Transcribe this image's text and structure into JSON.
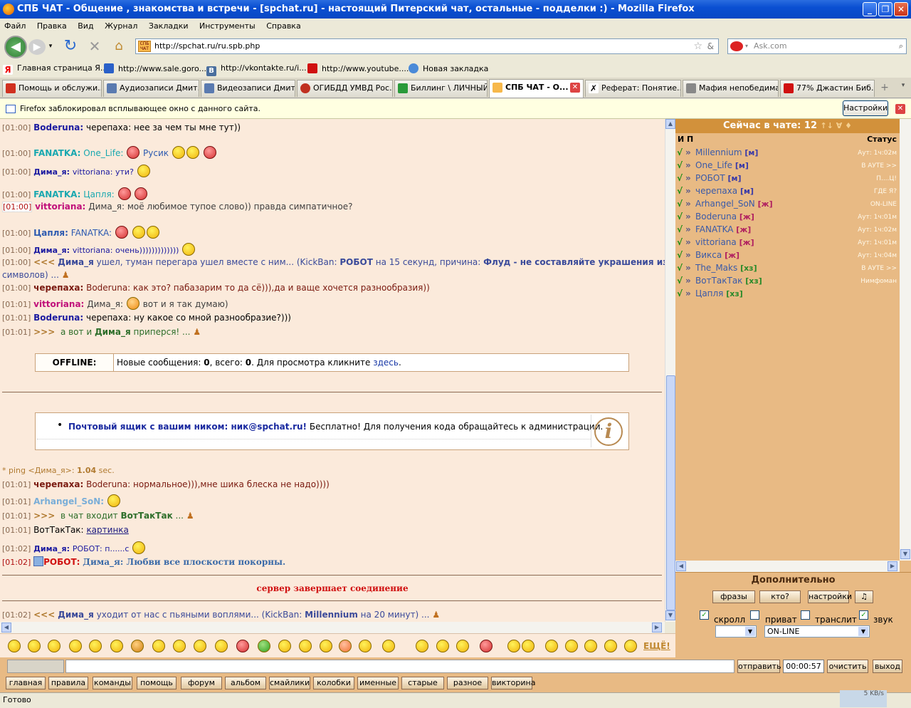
{
  "window": {
    "title": "СПБ ЧАТ - Общение , знакомства и встречи - [spchat.ru] - настоящий Питерский чат, остальные - подделки :) - Mozilla Firefox",
    "min": "_",
    "max": "❐",
    "close": "✕"
  },
  "menu": [
    "Файл",
    "Правка",
    "Вид",
    "Журнал",
    "Закладки",
    "Инструменты",
    "Справка"
  ],
  "nav": {
    "url": "http://spchat.ru/ru.spb.php",
    "url_icon_text": "СПБ ЧАТ",
    "search_placeholder": "Ask.com"
  },
  "bookmarks": [
    "Главная страница Я...",
    "http://www.sale.goro...",
    "http://vkontakte.ru/i...",
    "http://www.youtube....",
    "Новая закладка"
  ],
  "tabs": [
    "Помощь и обслужи...",
    "Аудиозаписи Дмит...",
    "Видеозаписи Дмит...",
    "ОГИБДД УМВД Рос...",
    "Биллинг \\ ЛИЧНЫЙ...",
    "СПБ ЧАТ - О...",
    "Реферат: Понятие...",
    "Мафия непобедима",
    "77% Джастин Биб..."
  ],
  "notification": {
    "text": "Firefox заблокировал всплывающее окно с данного сайта.",
    "button": "Настройки"
  },
  "chat": {
    "messages": [
      {
        "time": "[01:00]",
        "nick": "Boderuna:",
        "text": "черепаха: нее за чем ты мне тут))"
      },
      {
        "time": "[01:00]",
        "nick": "FANATKA:",
        "text": "One_Life:",
        "text2": "Русик"
      },
      {
        "time": "[01:00]",
        "nick": "Дима_я:",
        "text": "vittoriana: ути?"
      },
      {
        "time": "[01:00]",
        "nick": "FANATKA:",
        "text": "Цапля:"
      },
      {
        "time": "[01:00]",
        "nick": "vittoriana:",
        "text": "Дима_я: моё любимое тупое слово)) правда симпатичное?"
      },
      {
        "time": "[01:00]",
        "nick": "Цапля:",
        "text": "FANATKA:"
      },
      {
        "time": "[01:00]",
        "nick": "Дима_я:",
        "text": "vittoriana: очень)))))))))))))"
      },
      {
        "time": "[01:00]",
        "arrows": "<<<",
        "nick": "Дима_я",
        "text": "ушел, туман перегара ушел вместе с ним... (KickBan:",
        "bot": "РОБОТ",
        "text2": "на 15 секунд, причина:",
        "reason": "Флуд - не составляйте украшения из",
        "text3": "символов) ..."
      },
      {
        "time": "[01:00]",
        "nick": "черепаха:",
        "text": "Boderuna: как это? пабазарим то да сё))),да и ваще хочется разнообразия))"
      },
      {
        "time": "[01:01]",
        "nick": "vittoriana:",
        "text": "Дима_я:",
        "text2": "вот и я так думаю)"
      },
      {
        "time": "[01:01]",
        "nick": "Boderuna:",
        "text": "черепаха: ну какое со мной разнообразие?)))"
      },
      {
        "time": "[01:01]",
        "arrows": ">>>",
        "pre": "а вот и",
        "nick": "Дима_я",
        "text": "приперся! ..."
      }
    ],
    "offline": {
      "label": "OFFLINE:",
      "pre": "Новые сообщения:",
      "new": "0",
      "mid": ", всего:",
      "total": "0",
      "post": ". Для просмотра кликните",
      "link": "здесь",
      "end": "."
    },
    "info": {
      "bold": "Почтовый ящик с вашим ником: ник@spchat.ru!",
      "rest": "Бесплатно! Для получения кода обращайтесь к администрации."
    },
    "ping": {
      "pre": "* ping <Дима_я>:",
      "value": "1.04",
      "unit": "sec."
    },
    "messages2": [
      {
        "time": "[01:01]",
        "nick": "черепаха:",
        "text": "Boderuna: нормальное))),мне шика блеска не надо))))"
      },
      {
        "time": "[01:01]",
        "nick": "Arhangel_SoN:"
      },
      {
        "time": "[01:01]",
        "arrows": ">>>",
        "pre": "в чат входит",
        "nick": "ВотТакТак",
        "text": "..."
      },
      {
        "time": "[01:01]",
        "nick": "ВотТакТак:",
        "link": "картинка"
      },
      {
        "time": "[01:02]",
        "nick": "Дима_я:",
        "text": "РОБОТ: п......с"
      },
      {
        "time": "[01:02]",
        "nick": "РОБОТ:",
        "text": "Дима_я: Любви все плоскости покорны."
      }
    ],
    "server": "сервер завершает соединение",
    "last": {
      "time": "[01:02]",
      "arrows": "<<<",
      "nick": "Дима_я",
      "text": "уходит от нас с пьяными воплями... (KickBan:",
      "bot": "Millennium",
      "text2": "на 20 минут) ..."
    }
  },
  "smileys": {
    "more": "ЕЩЁ!"
  },
  "input": {
    "send": "отправить",
    "timer": "00:00:57",
    "clear": "очистить",
    "exit": "выход"
  },
  "navbuttons": [
    "главная",
    "правила",
    "команды",
    "помощь",
    "форум",
    "альбом",
    "смайлики",
    "колобки",
    "именные",
    "старые",
    "разное",
    "викторина"
  ],
  "status": {
    "text": "Готово",
    "speed": "5 KB/s"
  },
  "rpanel": {
    "header": "Сейчас в чате: 12",
    "header_icons": "↑↓ ∀ ♦",
    "col_name": "И П",
    "col_status": "Статус",
    "users": [
      {
        "name": "Millennium",
        "sex": "[м]",
        "status": "Аут: 1ч:02м"
      },
      {
        "name": "One_Life",
        "sex": "[м]",
        "status": "В АУТЕ >>"
      },
      {
        "name": "РОБОТ",
        "sex": "[м]",
        "status": "П....Ц!"
      },
      {
        "name": "черепаха",
        "sex": "[м]",
        "status": "ГДЕ Я?"
      },
      {
        "name": "Arhangel_SoN",
        "sex": "[ж]",
        "status": "ON-LINE"
      },
      {
        "name": "Boderuna",
        "sex": "[ж]",
        "status": "Аут: 1ч:01м"
      },
      {
        "name": "FANATKA",
        "sex": "[ж]",
        "status": "Аут: 1ч:02м"
      },
      {
        "name": "vittoriana",
        "sex": "[ж]",
        "status": "Аут: 1ч:01м"
      },
      {
        "name": "Викса",
        "sex": "[ж]",
        "status": "Аут: 1ч:04м"
      },
      {
        "name": "The_Maks",
        "sex": "[хз]",
        "status": "В АУТЕ >>"
      },
      {
        "name": "ВотТакТак",
        "sex": "[хз]",
        "status": "Нимфоман"
      },
      {
        "name": "Цапля",
        "sex": "[хз]",
        "status": ""
      }
    ],
    "extra": "Дополнительно",
    "buttons": [
      "фразы",
      "кто?",
      "настройки",
      "♫"
    ],
    "checkboxes": [
      {
        "label": "скролл",
        "checked": true
      },
      {
        "label": "приват",
        "checked": false
      },
      {
        "label": "транслит",
        "checked": false
      },
      {
        "label": "звук",
        "checked": true
      }
    ],
    "select1": "",
    "select2": "ON-LINE"
  }
}
